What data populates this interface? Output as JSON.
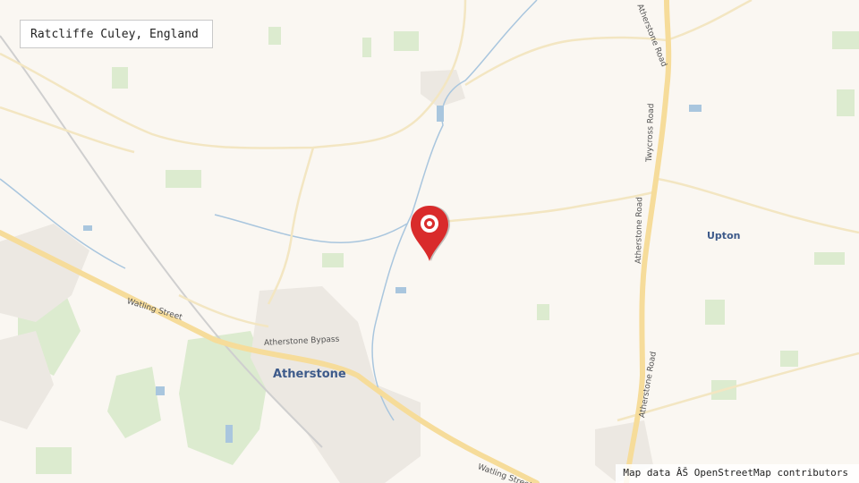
{
  "map": {
    "title": "Ratcliffe Culey, England",
    "attribution": "Map data ÂŠ OpenStreetMap contributors",
    "marker_icon": "map-pin-icon",
    "marker_color": "#d92b2b",
    "colors": {
      "background": "#faf7f2",
      "major_road": "#f6dc9a",
      "minor_road": "#f3e6c2",
      "water": "#a9c6de",
      "woods": "#dcebcf",
      "urban": "#ece8e2"
    },
    "places": {
      "town": "Atherstone",
      "village": "Upton"
    },
    "roads": {
      "watling_1": "Watling Street",
      "watling_2": "Watling Street",
      "bypass": "Atherstone Bypass",
      "atherstone_road_1": "Atherstone Road",
      "atherstone_road_2": "Atherstone Road",
      "atherstone_road_top": "Atherstone Road",
      "twycross_road": "Twycross Road"
    }
  }
}
